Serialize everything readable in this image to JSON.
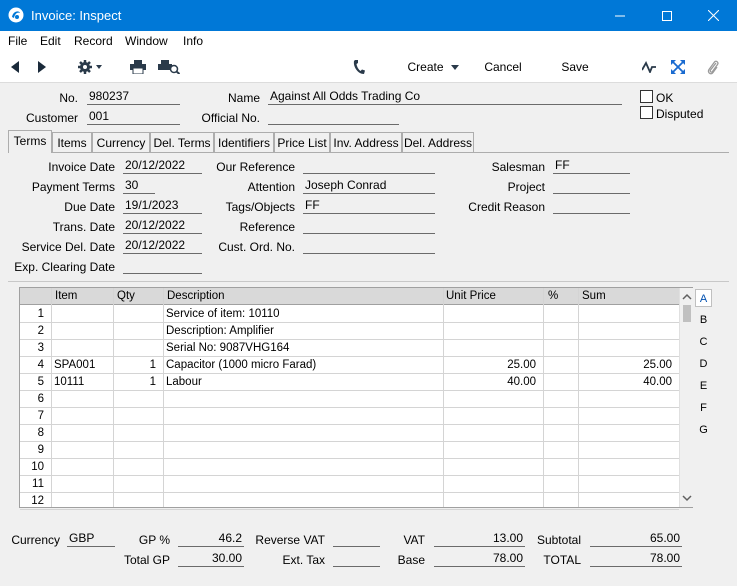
{
  "window": {
    "title": "Invoice: Inspect",
    "minimize_glyph": "—",
    "maximize_glyph": "☐",
    "close_glyph": "✕"
  },
  "menu": {
    "items": [
      "File",
      "Edit",
      "Record",
      "Window",
      "Info"
    ]
  },
  "toolbar": {
    "create_label": "Create",
    "cancel_label": "Cancel",
    "save_label": "Save"
  },
  "header": {
    "no_label": "No.",
    "no_value": "980237",
    "name_label": "Name",
    "name_value": "Against All Odds Trading Co",
    "customer_label": "Customer",
    "customer_value": "001",
    "official_no_label": "Official No.",
    "official_no_value": "",
    "ok_label": "OK",
    "disputed_label": "Disputed"
  },
  "tabs": [
    "Terms",
    "Items",
    "Currency",
    "Del. Terms",
    "Identifiers",
    "Price List",
    "Inv. Address",
    "Del. Address"
  ],
  "terms": {
    "invoice_date_label": "Invoice Date",
    "invoice_date": "20/12/2022",
    "payment_terms_label": "Payment Terms",
    "payment_terms": "30",
    "due_date_label": "Due Date",
    "due_date": "19/1/2023",
    "trans_date_label": "Trans. Date",
    "trans_date": "20/12/2022",
    "service_del_date_label": "Service Del. Date",
    "service_del_date": "20/12/2022",
    "exp_clearing_date_label": "Exp. Clearing Date",
    "exp_clearing_date": "",
    "our_reference_label": "Our Reference",
    "our_reference": "",
    "attention_label": "Attention",
    "attention": "Joseph Conrad",
    "tags_label": "Tags/Objects",
    "tags": "FF",
    "reference_label": "Reference",
    "reference": "",
    "cust_ord_no_label": "Cust. Ord. No.",
    "cust_ord_no": "",
    "salesman_label": "Salesman",
    "salesman": "FF",
    "project_label": "Project",
    "project": "",
    "credit_reason_label": "Credit Reason",
    "credit_reason": ""
  },
  "grid": {
    "headers": {
      "item": "Item",
      "qty": "Qty",
      "description": "Description",
      "unit_price": "Unit Price",
      "pct": "%",
      "sum": "Sum"
    },
    "rows": [
      {
        "n": "1",
        "item": "",
        "qty": "",
        "description": "Service of item: 10110",
        "unit_price": "",
        "pct": "",
        "sum": ""
      },
      {
        "n": "2",
        "item": "",
        "qty": "",
        "description": "Description: Amplifier",
        "unit_price": "",
        "pct": "",
        "sum": ""
      },
      {
        "n": "3",
        "item": "",
        "qty": "",
        "description": "Serial No: 9087VHG164",
        "unit_price": "",
        "pct": "",
        "sum": ""
      },
      {
        "n": "4",
        "item": "SPA001",
        "qty": "1",
        "description": "Capacitor (1000 micro Farad)",
        "unit_price": "25.00",
        "pct": "",
        "sum": "25.00"
      },
      {
        "n": "5",
        "item": "10111",
        "qty": "1",
        "description": "Labour",
        "unit_price": "40.00",
        "pct": "",
        "sum": "40.00"
      },
      {
        "n": "6",
        "item": "",
        "qty": "",
        "description": "",
        "unit_price": "",
        "pct": "",
        "sum": ""
      },
      {
        "n": "7",
        "item": "",
        "qty": "",
        "description": "",
        "unit_price": "",
        "pct": "",
        "sum": ""
      },
      {
        "n": "8",
        "item": "",
        "qty": "",
        "description": "",
        "unit_price": "",
        "pct": "",
        "sum": ""
      },
      {
        "n": "9",
        "item": "",
        "qty": "",
        "description": "",
        "unit_price": "",
        "pct": "",
        "sum": ""
      },
      {
        "n": "10",
        "item": "",
        "qty": "",
        "description": "",
        "unit_price": "",
        "pct": "",
        "sum": ""
      },
      {
        "n": "11",
        "item": "",
        "qty": "",
        "description": "",
        "unit_price": "",
        "pct": "",
        "sum": ""
      },
      {
        "n": "12",
        "item": "",
        "qty": "",
        "description": "",
        "unit_price": "",
        "pct": "",
        "sum": ""
      }
    ],
    "row_buttons": [
      "A",
      "B",
      "C",
      "D",
      "E",
      "F",
      "G"
    ]
  },
  "footer": {
    "currency_label": "Currency",
    "currency": "GBP",
    "gp_pct_label": "GP %",
    "gp_pct": "46.2",
    "total_gp_label": "Total GP",
    "total_gp": "30.00",
    "reverse_vat_label": "Reverse VAT",
    "reverse_vat": "",
    "ext_tax_label": "Ext. Tax",
    "ext_tax": "",
    "vat_label": "VAT",
    "vat": "13.00",
    "base_label": "Base",
    "base": "78.00",
    "subtotal_label": "Subtotal",
    "subtotal": "65.00",
    "total_label": "TOTAL",
    "total": "78.00"
  },
  "colors": {
    "titlebar": "#0078d7",
    "accent": "#0050b0"
  }
}
